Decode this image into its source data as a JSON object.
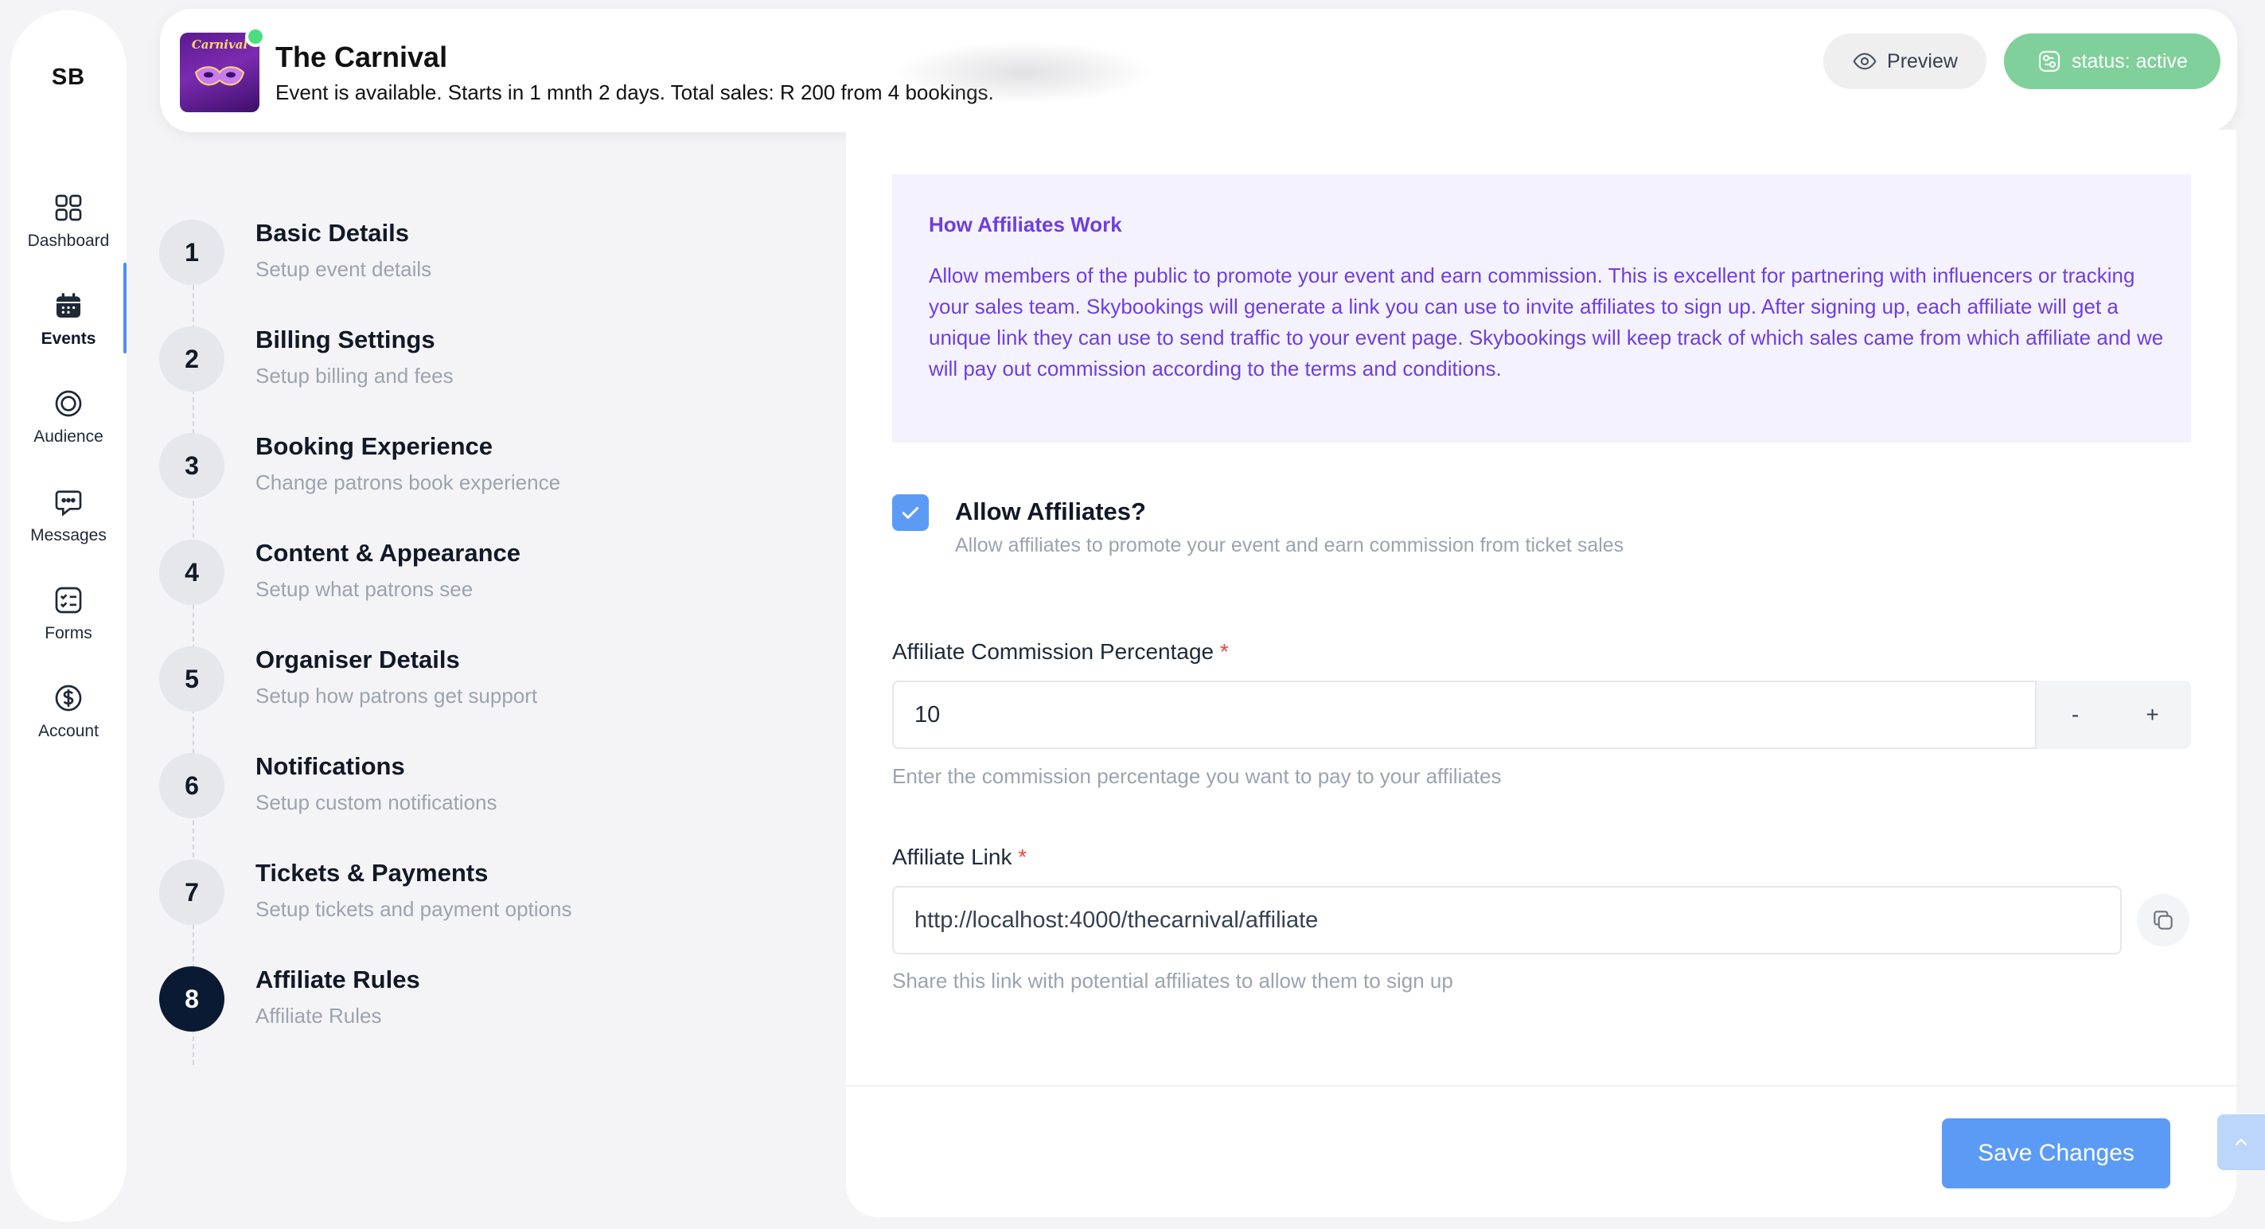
{
  "nav": {
    "logo": "SB",
    "items": [
      {
        "label": "Dashboard",
        "icon": "dashboard-grid-icon"
      },
      {
        "label": "Events",
        "icon": "calendar-icon"
      },
      {
        "label": "Audience",
        "icon": "audience-circle-icon"
      },
      {
        "label": "Messages",
        "icon": "messages-chat-icon"
      },
      {
        "label": "Forms",
        "icon": "forms-checklist-icon"
      },
      {
        "label": "Account",
        "icon": "dollar-circle-icon"
      }
    ],
    "active": "Events"
  },
  "header": {
    "title": "The Carnival",
    "subtitle": "Event is available. Starts in 1 mnth 2 days. Total sales: R 200 from 4 bookings.",
    "thumb_text": "Carnival",
    "preview_label": "Preview",
    "status_label": "status: active"
  },
  "steps": [
    {
      "num": "1",
      "title": "Basic Details",
      "desc": "Setup event details"
    },
    {
      "num": "2",
      "title": "Billing Settings",
      "desc": "Setup billing and fees"
    },
    {
      "num": "3",
      "title": "Booking Experience",
      "desc": "Change patrons book experience"
    },
    {
      "num": "4",
      "title": "Content & Appearance",
      "desc": "Setup what patrons see"
    },
    {
      "num": "5",
      "title": "Organiser Details",
      "desc": "Setup how patrons get support"
    },
    {
      "num": "6",
      "title": "Notifications",
      "desc": "Setup custom notifications"
    },
    {
      "num": "7",
      "title": "Tickets & Payments",
      "desc": "Setup tickets and payment options"
    },
    {
      "num": "8",
      "title": "Affiliate Rules",
      "desc": "Affiliate Rules"
    }
  ],
  "current_step": "8",
  "info": {
    "title": "How Affiliates Work",
    "text": "Allow members of the public to promote your event and earn commission. This is excellent for partnering with influencers or tracking your sales team. Skybookings will generate a link you can use to invite affiliates to sign up. After signing up, each affiliate will get a unique link they can use to send traffic to your event page. Skybookings will keep track of which sales came from which affiliate and we will pay out commission according to the terms and conditions."
  },
  "allow_affiliates": {
    "checked": true,
    "label": "Allow Affiliates?",
    "desc": "Allow affiliates to promote your event and earn commission from ticket sales"
  },
  "commission": {
    "label": "Affiliate Commission Percentage",
    "required_mark": "*",
    "value": "10",
    "decrement": "-",
    "increment": "+",
    "help": "Enter the commission percentage you want to pay to your affiliates"
  },
  "link": {
    "label": "Affiliate Link",
    "required_mark": "*",
    "value": "http://localhost:4000/thecarnival/affiliate",
    "help": "Share this link with potential affiliates to allow them to sign up"
  },
  "save_label": "Save Changes",
  "colors": {
    "accent": "#5b9bf5",
    "status": "#7fd09a",
    "info_text": "#6d3fe0",
    "info_bg": "#f5f2ff",
    "current_step": "#0b1a33"
  }
}
